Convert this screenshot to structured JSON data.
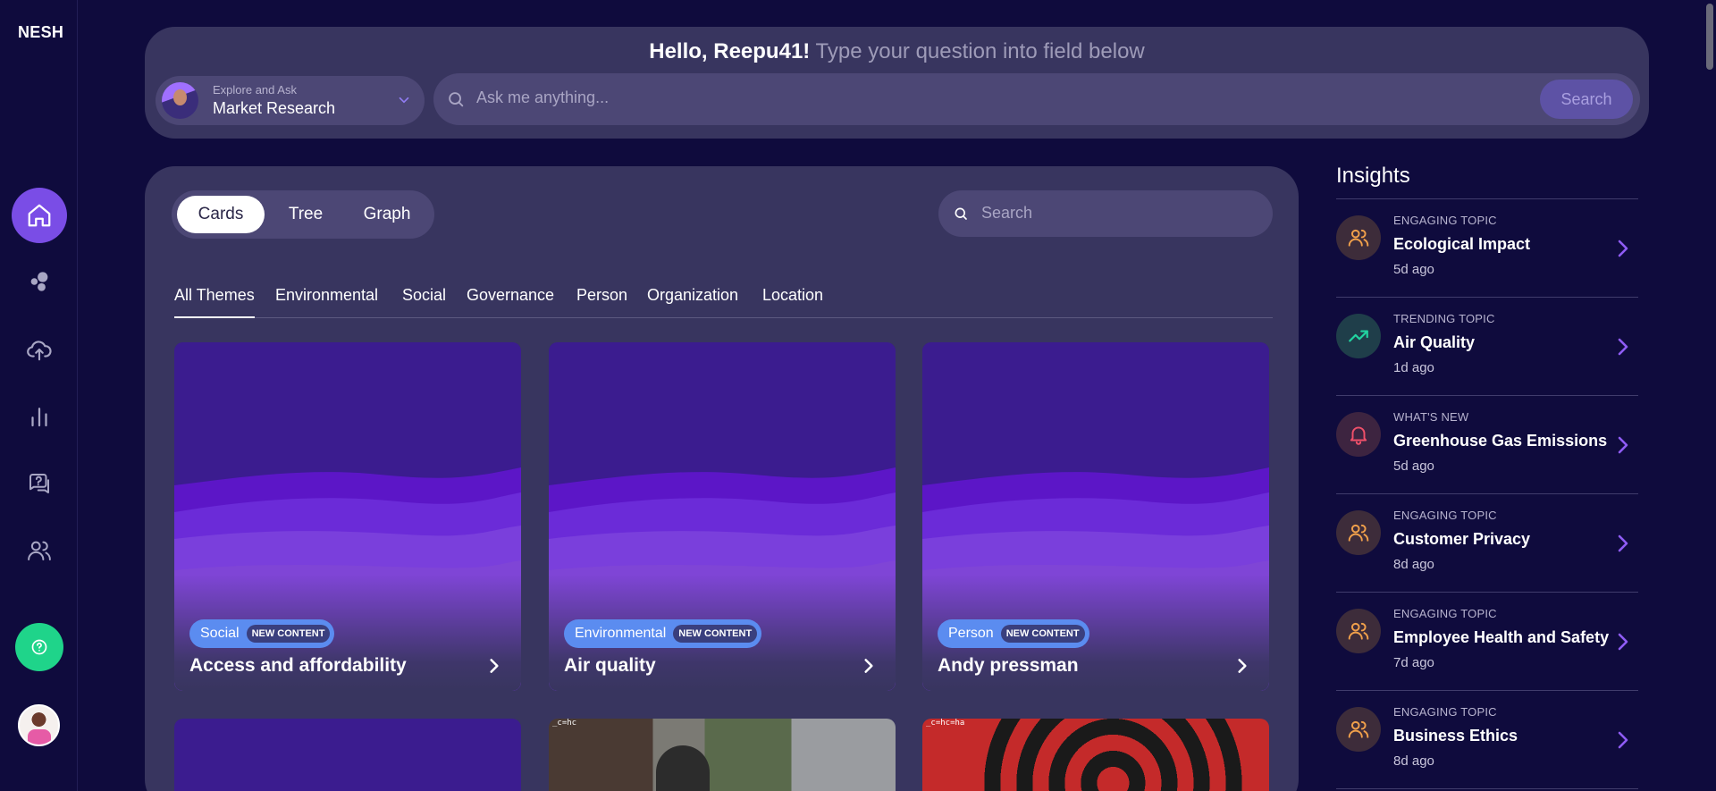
{
  "app": {
    "logo": "NESH"
  },
  "sidebar": {
    "items": [
      {
        "name": "home",
        "icon": "home-icon",
        "active": true
      },
      {
        "name": "topics",
        "icon": "bubbles-icon",
        "active": false
      },
      {
        "name": "upload",
        "icon": "cloud-upload-icon",
        "active": false
      },
      {
        "name": "analytics",
        "icon": "bar-chart-icon",
        "active": false
      },
      {
        "name": "questions",
        "icon": "chat-question-icon",
        "active": false
      },
      {
        "name": "users",
        "icon": "users-icon",
        "active": false
      }
    ],
    "help_icon": "question-circle-icon",
    "help_color": "#1fd48a",
    "accent": "#7a4de6"
  },
  "header": {
    "greeting": "Hello, Reepu41!",
    "prompt": "Type your question into field below",
    "selector": {
      "small_label": "Explore and Ask",
      "value": "Market Research"
    },
    "ask": {
      "placeholder": "Ask me anything...",
      "button": "Search"
    }
  },
  "main": {
    "views": [
      "Cards",
      "Tree",
      "Graph"
    ],
    "active_view": "Cards",
    "search_placeholder": "Search",
    "themes": [
      "All Themes",
      "Environmental",
      "Social",
      "Governance",
      "Person",
      "Organization",
      "Location"
    ],
    "active_theme": "All Themes",
    "cards": [
      {
        "tag": "Social",
        "badge": "NEW CONTENT",
        "title": "Access and affordability"
      },
      {
        "tag": "Environmental",
        "badge": "NEW CONTENT",
        "title": "Air quality"
      },
      {
        "tag": "Person",
        "badge": "NEW CONTENT",
        "title": "Andy pressman"
      }
    ],
    "second_row": [
      {
        "kind": "purple",
        "caption": ""
      },
      {
        "kind": "street",
        "caption": "_c=hc"
      },
      {
        "kind": "spiral",
        "caption": "_c=hc=ha"
      }
    ]
  },
  "insights": {
    "title": "Insights",
    "items": [
      {
        "category": "ENGAGING TOPIC",
        "title": "Ecological Impact",
        "ago": "5d ago",
        "icon": "users-icon",
        "color": "#f0a04b"
      },
      {
        "category": "TRENDING TOPIC",
        "title": "Air Quality",
        "ago": "1d ago",
        "icon": "trending-up-icon",
        "color": "#22d3a0"
      },
      {
        "category": "WHAT'S NEW",
        "title": "Greenhouse Gas Emissions",
        "ago": "5d ago",
        "icon": "bell-icon",
        "color": "#f0506a"
      },
      {
        "category": "ENGAGING TOPIC",
        "title": "Customer Privacy",
        "ago": "8d ago",
        "icon": "users-icon",
        "color": "#f0a04b"
      },
      {
        "category": "ENGAGING TOPIC",
        "title": "Employee Health and Safety",
        "ago": "7d ago",
        "icon": "users-icon",
        "color": "#f0a04b"
      },
      {
        "category": "ENGAGING TOPIC",
        "title": "Business Ethics",
        "ago": "8d ago",
        "icon": "users-icon",
        "color": "#f0a04b"
      }
    ]
  }
}
